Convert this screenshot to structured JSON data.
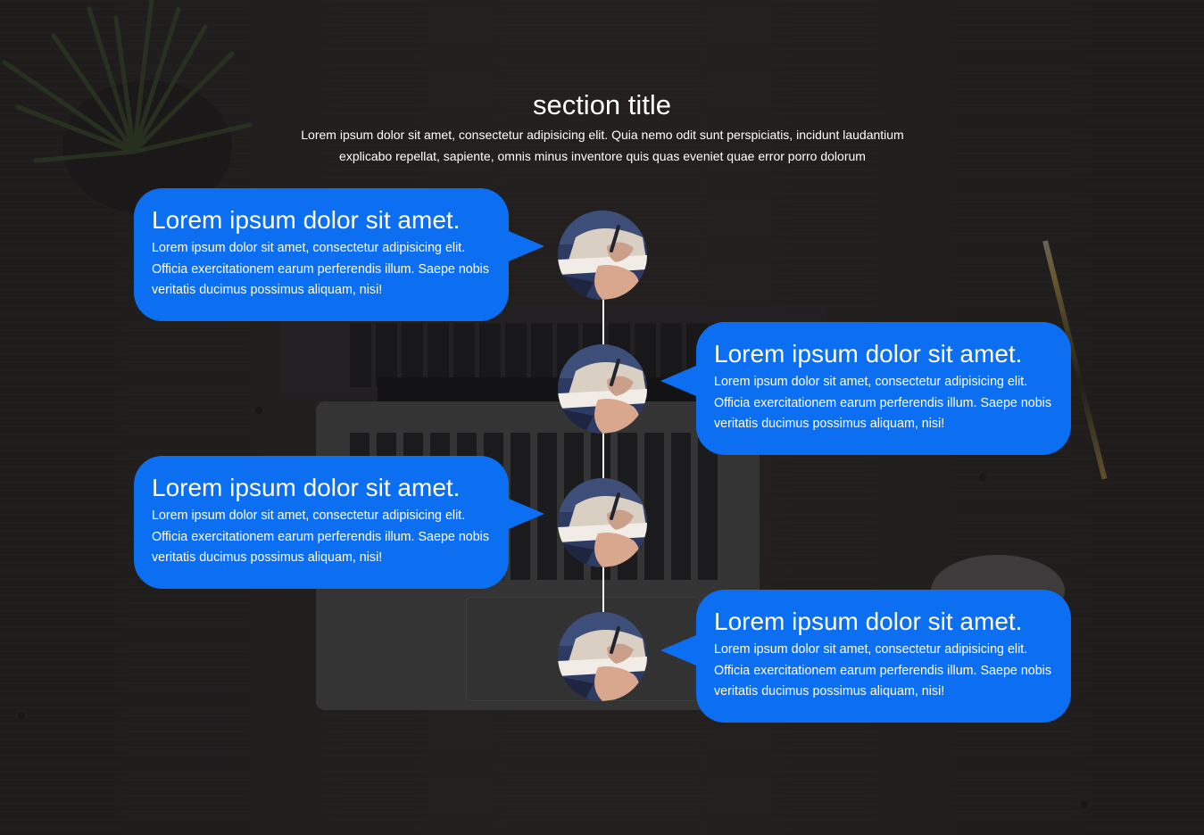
{
  "section": {
    "title": "section title",
    "description": "Lorem ipsum dolor sit amet, consectetur adipisicing elit. Quia nemo odit sunt perspiciatis, incidunt laudantium explicabo repellat, sapiente, omnis minus inventore quis quas eveniet quae error porro dolorum"
  },
  "timeline": {
    "items": [
      {
        "side": "left",
        "title": "Lorem ipsum dolor sit amet.",
        "text": "Lorem ipsum dolor sit amet, consectetur adipisicing elit. Officia exercitationem earum perferendis illum. Saepe nobis veritatis ducimus possimus aliquam, nisi!"
      },
      {
        "side": "right",
        "title": "Lorem ipsum dolor sit amet.",
        "text": "Lorem ipsum dolor sit amet, consectetur adipisicing elit. Officia exercitationem earum perferendis illum. Saepe nobis veritatis ducimus possimus aliquam, nisi!"
      },
      {
        "side": "left",
        "title": "Lorem ipsum dolor sit amet.",
        "text": "Lorem ipsum dolor sit amet, consectetur adipisicing elit. Officia exercitationem earum perferendis illum. Saepe nobis veritatis ducimus possimus aliquam, nisi!"
      },
      {
        "side": "right",
        "title": "Lorem ipsum dolor sit amet.",
        "text": "Lorem ipsum dolor sit amet, consectetur adipisicing elit. Officia exercitationem earum perferendis illum. Saepe nobis veritatis ducimus possimus aliquam, nisi!"
      }
    ]
  },
  "colors": {
    "card_background": "#0c6ef0",
    "text": "#ffffff",
    "timeline_line": "#ffffff"
  },
  "icons": {
    "avatar": "writing-hand-photo"
  }
}
